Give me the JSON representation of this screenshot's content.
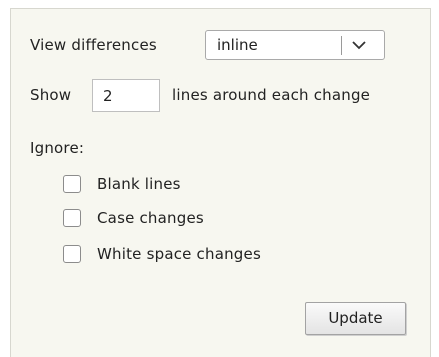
{
  "view_differences": {
    "label": "View differences",
    "selected": "inline",
    "dropdown_icon": "chevron-down-icon"
  },
  "context": {
    "show_label": "Show",
    "value": "2",
    "suffix_label": "lines around each change"
  },
  "ignore": {
    "heading": "Ignore:",
    "options": [
      {
        "label": "Blank lines",
        "checked": false
      },
      {
        "label": "Case changes",
        "checked": false
      },
      {
        "label": "White space changes",
        "checked": false
      }
    ]
  },
  "update_button": {
    "label": "Update"
  }
}
